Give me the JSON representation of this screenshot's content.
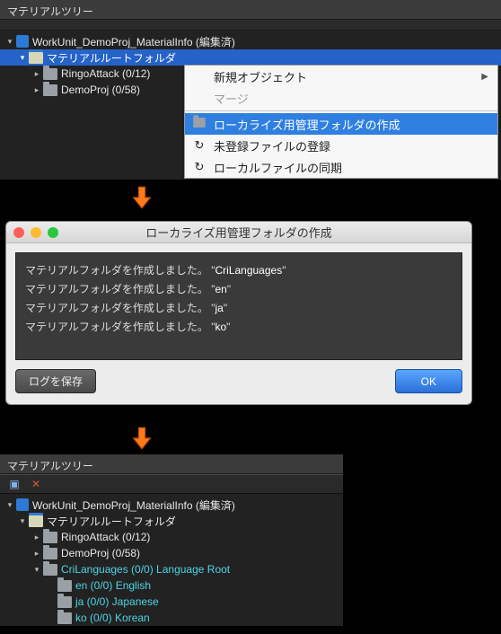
{
  "panel1": {
    "title": "マテリアルツリー",
    "tree": {
      "workunit": "WorkUnit_DemoProj_MaterialInfo (編集済)",
      "root": "マテリアルルートフォルダ",
      "items": [
        "RingoAttack (0/12)",
        "DemoProj (0/58)"
      ]
    }
  },
  "ctxmenu": {
    "new_object": "新規オブジェクト",
    "merge": "マージ",
    "create_locale": "ローカライズ用管理フォルダの作成",
    "register_files": "未登録ファイルの登録",
    "sync_local": "ローカルファイルの同期"
  },
  "dialog": {
    "title": "ローカライズ用管理フォルダの作成",
    "line_prefix": "マテリアルフォルダを作成しました。",
    "created": [
      "CriLanguages",
      "en",
      "ja",
      "ko"
    ],
    "save_log": "ログを保存",
    "ok": "OK"
  },
  "panel3": {
    "title": "マテリアルツリー",
    "tree": {
      "workunit": "WorkUnit_DemoProj_MaterialInfo (編集済)",
      "root": "マテリアルルートフォルダ",
      "ringo": "RingoAttack (0/12)",
      "demo": "DemoProj (0/58)",
      "cri": "CriLanguages (0/0) Language Root",
      "en": "en (0/0) English",
      "ja": "ja (0/0) Japanese",
      "ko": "ko (0/0) Korean"
    }
  }
}
